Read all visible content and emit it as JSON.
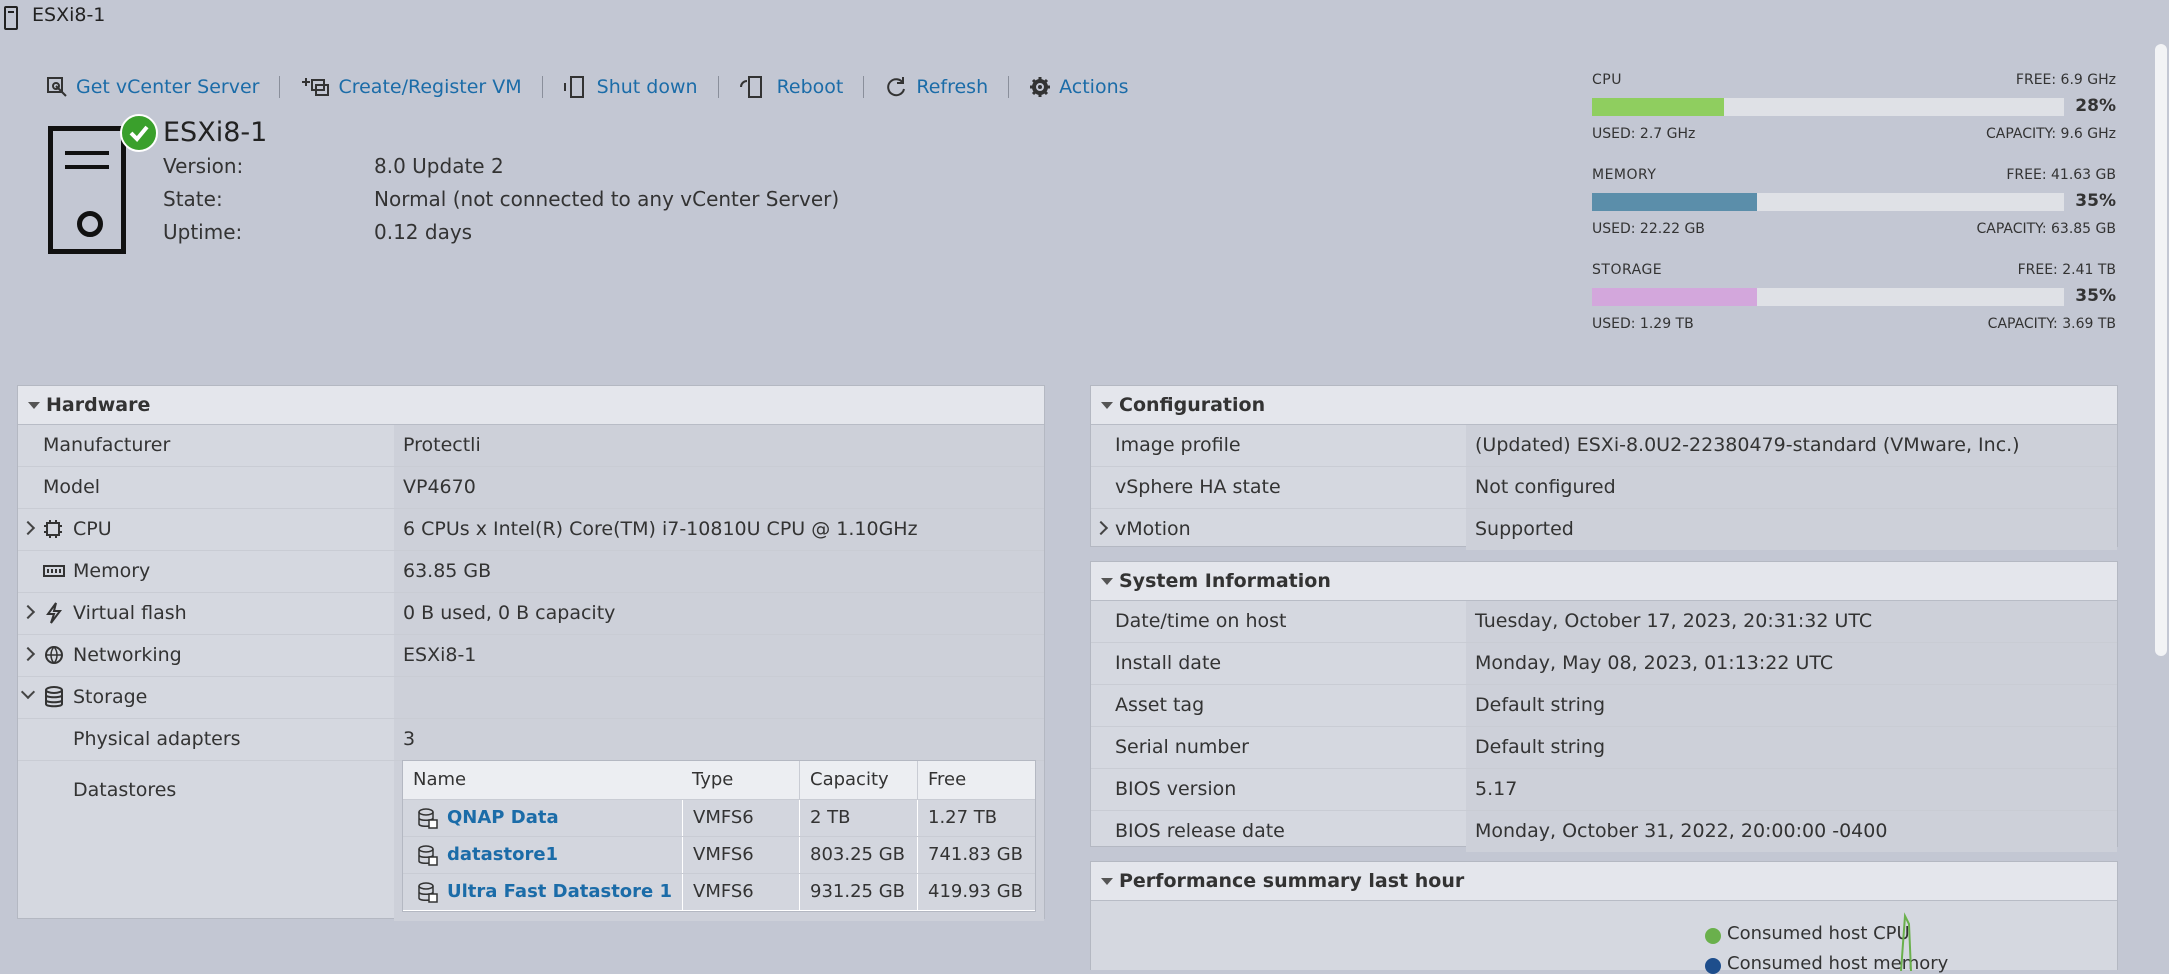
{
  "window": {
    "title": "ESXi8-1"
  },
  "toolbar": {
    "get_vcenter": "Get vCenter Server",
    "create_register": "Create/Register VM",
    "shut_down": "Shut down",
    "reboot": "Reboot",
    "refresh": "Refresh",
    "actions": "Actions"
  },
  "host": {
    "name": "ESXi8-1",
    "version_label": "Version:",
    "version": "8.0 Update 2",
    "state_label": "State:",
    "state": "Normal (not connected to any vCenter Server)",
    "uptime_label": "Uptime:",
    "uptime": "0.12 days"
  },
  "resources": {
    "cpu": {
      "label": "CPU",
      "free": "FREE: 6.9 GHz",
      "percent": "28%",
      "fraction": 0.28,
      "used": "USED: 2.7 GHz",
      "capacity": "CAPACITY: 9.6 GHz",
      "color": "#8fce5f"
    },
    "memory": {
      "label": "MEMORY",
      "free": "FREE: 41.63 GB",
      "percent": "35%",
      "fraction": 0.35,
      "used": "USED: 22.22 GB",
      "capacity": "CAPACITY: 63.85 GB",
      "color": "#5b8eaa"
    },
    "storage": {
      "label": "STORAGE",
      "free": "FREE: 2.41 TB",
      "percent": "35%",
      "fraction": 0.35,
      "used": "USED: 1.29 TB",
      "capacity": "CAPACITY: 3.69 TB",
      "color": "#d3a7dc"
    }
  },
  "hardware": {
    "title": "Hardware",
    "manufacturer_label": "Manufacturer",
    "manufacturer": "Protectli",
    "model_label": "Model",
    "model": "VP4670",
    "cpu_label": "CPU",
    "cpu": "6 CPUs x Intel(R) Core(TM) i7-10810U CPU @ 1.10GHz",
    "memory_label": "Memory",
    "memory": "63.85 GB",
    "vflash_label": "Virtual flash",
    "vflash": "0 B used, 0 B capacity",
    "networking_label": "Networking",
    "networking": "ESXi8-1",
    "storage_label": "Storage",
    "phys_adapters_label": "Physical adapters",
    "phys_adapters": "3",
    "datastores_label": "Datastores",
    "datastores": {
      "headers": [
        "Name",
        "Type",
        "Capacity",
        "Free"
      ],
      "rows": [
        {
          "name": "QNAP Data",
          "type": "VMFS6",
          "capacity": "2 TB",
          "free": "1.27 TB"
        },
        {
          "name": "datastore1",
          "type": "VMFS6",
          "capacity": "803.25 GB",
          "free": "741.83 GB"
        },
        {
          "name": "Ultra Fast Datastore 1",
          "type": "VMFS6",
          "capacity": "931.25 GB",
          "free": "419.93 GB"
        }
      ]
    }
  },
  "configuration": {
    "title": "Configuration",
    "image_profile_label": "Image profile",
    "image_profile": "(Updated) ESXi-8.0U2-22380479-standard (VMware, Inc.)",
    "ha_label": "vSphere HA state",
    "ha": "Not configured",
    "vmotion_label": "vMotion",
    "vmotion": "Supported"
  },
  "system_info": {
    "title": "System Information",
    "datetime_label": "Date/time on host",
    "datetime": "Tuesday, October 17, 2023, 20:31:32 UTC",
    "install_label": "Install date",
    "install": "Monday, May 08, 2023, 01:13:22 UTC",
    "asset_label": "Asset tag",
    "asset": "Default string",
    "serial_label": "Serial number",
    "serial": "Default string",
    "bios_label": "BIOS version",
    "bios": "5.17",
    "bios_date_label": "BIOS release date",
    "bios_date": "Monday, October 31, 2022, 20:00:00 -0400"
  },
  "performance": {
    "title": "Performance summary last hour",
    "legend_cpu": "Consumed host CPU",
    "legend_mem": "Consumed host memory",
    "cpu_color": "#6ab04c",
    "mem_color": "#1e4e8c"
  }
}
